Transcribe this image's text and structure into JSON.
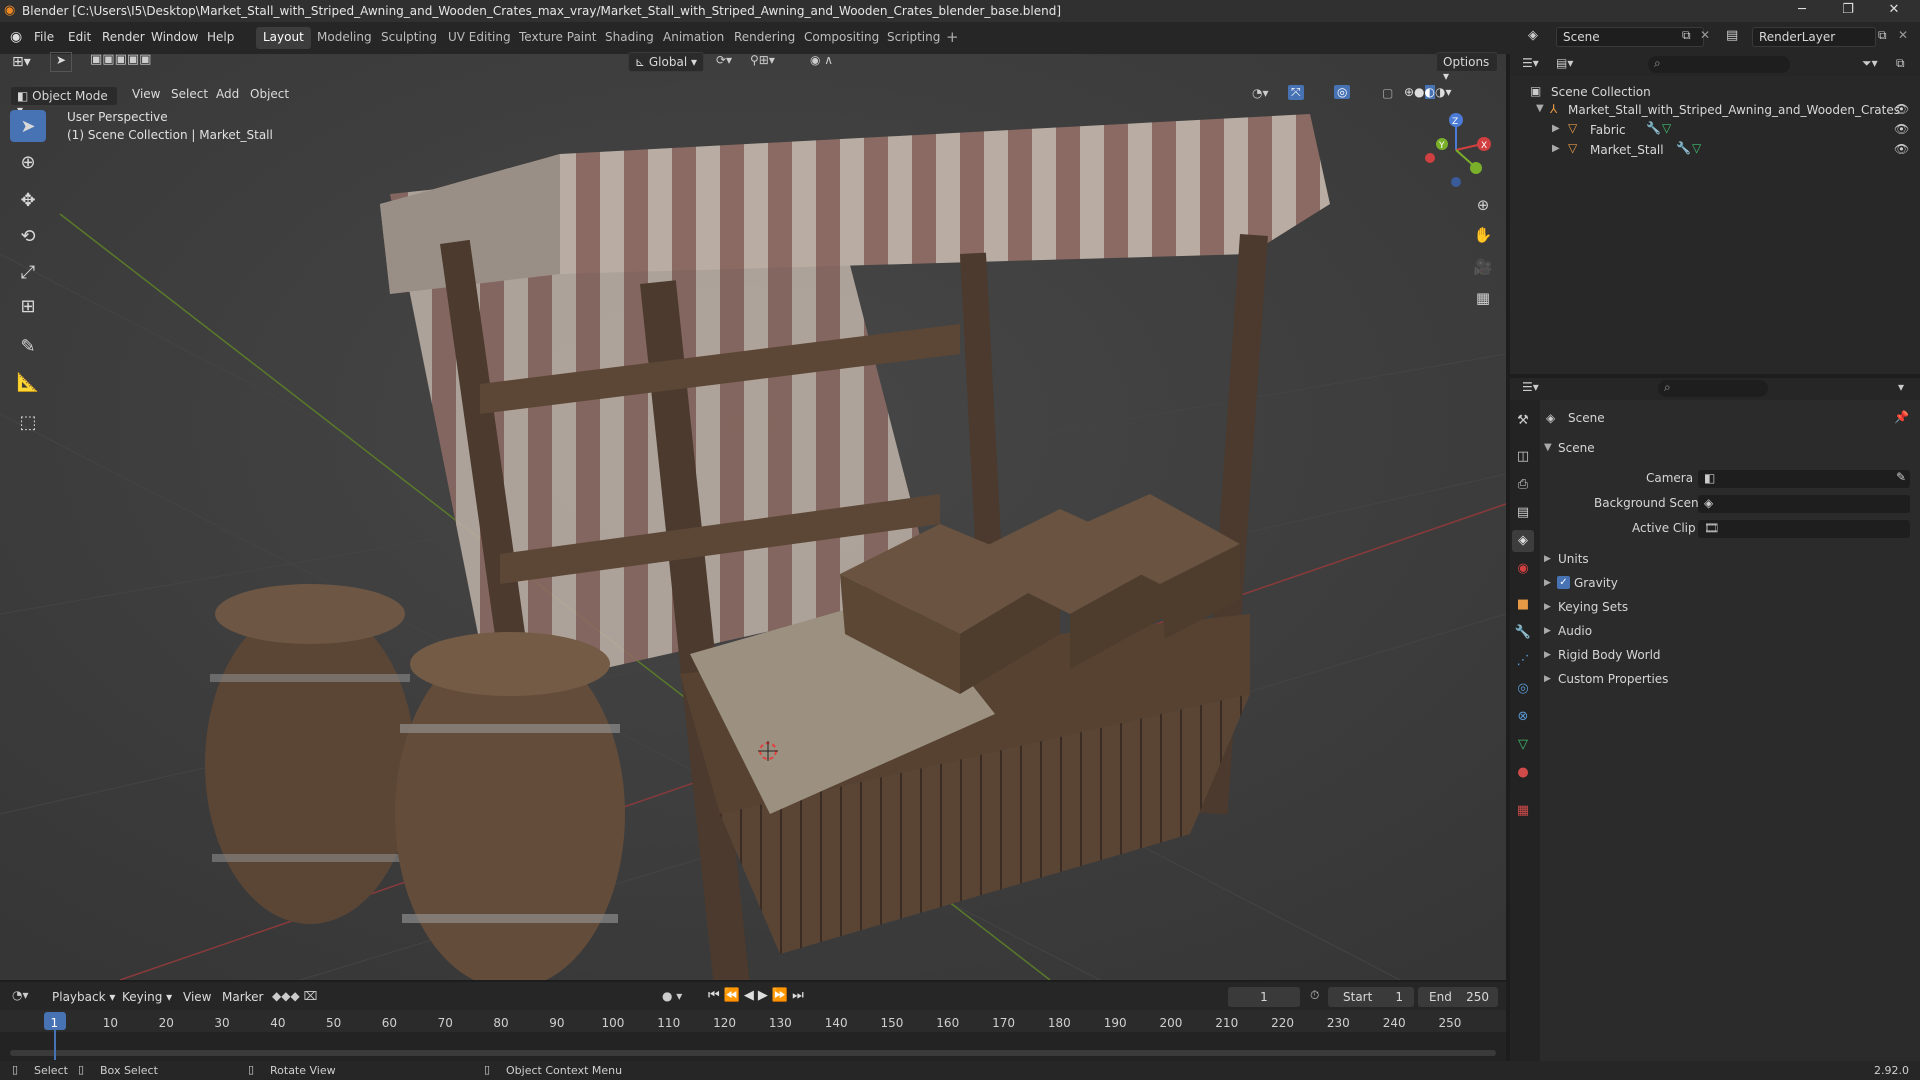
{
  "window": {
    "title": "Blender [C:\\Users\\I5\\Desktop\\Market_Stall_with_Striped_Awning_and_Wooden_Crates_max_vray/Market_Stall_with_Striped_Awning_and_Wooden_Crates_blender_base.blend]"
  },
  "menu": [
    "File",
    "Edit",
    "Render",
    "Window",
    "Help"
  ],
  "workspaces": [
    "Layout",
    "Modeling",
    "Sculpting",
    "UV Editing",
    "Texture Paint",
    "Shading",
    "Animation",
    "Rendering",
    "Compositing",
    "Scripting"
  ],
  "active_workspace": "Layout",
  "scene_name": "Scene",
  "render_layer": "RenderLayer",
  "viewport_header": {
    "mode": "Object Mode",
    "menus": [
      "View",
      "Select",
      "Add",
      "Object"
    ],
    "orientation": "Global",
    "options": "Options"
  },
  "viewport": {
    "perspective": "User Perspective",
    "collection_info": "(1) Scene Collection | Market_Stall"
  },
  "outliner": {
    "root": "Scene Collection",
    "items": [
      {
        "label": "Market_Stall_with_Striped_Awning_and_Wooden_Crates"
      },
      {
        "label": "Fabric"
      },
      {
        "label": "Market_Stall"
      }
    ]
  },
  "properties": {
    "header": "Scene",
    "section": "Scene",
    "fields": [
      {
        "label": "Camera"
      },
      {
        "label": "Background Scene"
      },
      {
        "label": "Active Clip"
      }
    ],
    "panels": [
      "Units",
      "Gravity",
      "Keying Sets",
      "Audio",
      "Rigid Body World",
      "Custom Properties"
    ],
    "gravity_checked": true
  },
  "timeline": {
    "menus": [
      "Playback",
      "Keying",
      "View",
      "Marker"
    ],
    "current_frame": "1",
    "start_label": "Start",
    "start": "1",
    "end_label": "End",
    "end": "250",
    "ruler": [
      "1",
      "10",
      "20",
      "30",
      "40",
      "50",
      "60",
      "70",
      "80",
      "90",
      "100",
      "110",
      "120",
      "130",
      "140",
      "150",
      "160",
      "170",
      "180",
      "190",
      "200",
      "210",
      "220",
      "230",
      "240",
      "250"
    ]
  },
  "statusbar": {
    "select": "Select",
    "box_select": "Box Select",
    "rotate": "Rotate View",
    "context": "Object Context Menu",
    "version": "2.92.0"
  },
  "colors": {
    "accent": "#4772b3",
    "viewport_bg": "#3d3d3d",
    "panel_bg": "#2b2b2b"
  }
}
